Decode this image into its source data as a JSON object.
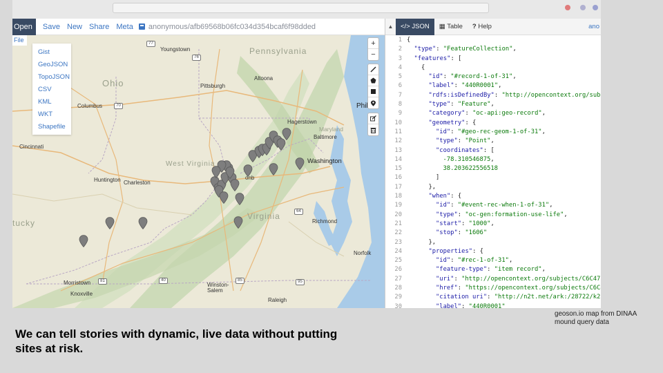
{
  "toolbar": {
    "open_label": "Open",
    "items": [
      "Save",
      "New",
      "Share",
      "Meta"
    ],
    "user_text": "anonymous/afb69568b06fc034d354bcaf6f98dded"
  },
  "file_menu": {
    "label": "File",
    "items": [
      "Gist",
      "GeoJSON",
      "TopoJSON",
      "CSV",
      "KML",
      "WKT",
      "Shapefile"
    ]
  },
  "map": {
    "state_labels": [
      "Pennsylvania",
      "Ohio",
      "West Virginia",
      "Virginia",
      "Maryland",
      "tucky"
    ],
    "places": [
      "Youngstown",
      "Pittsburgh",
      "Altoona",
      "Columbus",
      "Phil",
      "Hagerstown",
      "Baltimore",
      "Cincinnati",
      "Washington",
      "Huntington",
      "Charleston",
      "onb",
      "Richmond",
      "Norfolk",
      "Morristown",
      "Knoxville",
      "Winston-Salem",
      "Raleigh"
    ],
    "routes": [
      "77",
      "76",
      "70",
      "81",
      "40",
      "85",
      "95",
      "64"
    ],
    "controls": [
      "search-icon",
      "zoom-in",
      "zoom-out",
      "draw-line",
      "draw-polygon",
      "draw-rectangle",
      "draw-marker",
      "edit",
      "delete"
    ],
    "zoom_in": "+",
    "zoom_out": "−"
  },
  "panel": {
    "collapse_glyph": "▲",
    "tabs": [
      "JSON",
      "Table",
      "Help"
    ],
    "tab_prefixes": [
      "</>",
      "▦",
      "?"
    ],
    "active_tab": "JSON",
    "user_short": "ano",
    "lines": [
      {
        "n": "1",
        "i": 0,
        "parts": [
          [
            "{",
            "pun"
          ]
        ]
      },
      {
        "n": "2",
        "i": 1,
        "parts": [
          [
            "\"type\"",
            "key"
          ],
          [
            ": ",
            "pun"
          ],
          [
            "\"FeatureCollection\"",
            "str"
          ],
          [
            ",",
            "pun"
          ]
        ]
      },
      {
        "n": "3",
        "i": 1,
        "parts": [
          [
            "\"features\"",
            "key"
          ],
          [
            ": [",
            "pun"
          ]
        ]
      },
      {
        "n": "4",
        "i": 2,
        "parts": [
          [
            "{",
            "pun"
          ]
        ]
      },
      {
        "n": "5",
        "i": 3,
        "parts": [
          [
            "\"id\"",
            "key"
          ],
          [
            ": ",
            "pun"
          ],
          [
            "\"#record-1-of-31\"",
            "str"
          ],
          [
            ",",
            "pun"
          ]
        ]
      },
      {
        "n": "6",
        "i": 3,
        "parts": [
          [
            "\"label\"",
            "key"
          ],
          [
            ": ",
            "pun"
          ],
          [
            "\"440R0001\"",
            "str"
          ],
          [
            ",",
            "pun"
          ]
        ]
      },
      {
        "n": "7",
        "i": 3,
        "parts": [
          [
            "\"rdfs:isDefinedBy\"",
            "key"
          ],
          [
            ": ",
            "pun"
          ],
          [
            "\"http://opencontext.org/subj",
            "str"
          ]
        ]
      },
      {
        "n": "8",
        "i": 3,
        "parts": [
          [
            "\"type\"",
            "key"
          ],
          [
            ": ",
            "pun"
          ],
          [
            "\"Feature\"",
            "str"
          ],
          [
            ",",
            "pun"
          ]
        ]
      },
      {
        "n": "9",
        "i": 3,
        "parts": [
          [
            "\"category\"",
            "key"
          ],
          [
            ": ",
            "pun"
          ],
          [
            "\"oc-api:geo-record\"",
            "str"
          ],
          [
            ",",
            "pun"
          ]
        ]
      },
      {
        "n": "10",
        "i": 3,
        "parts": [
          [
            "\"geometry\"",
            "key"
          ],
          [
            ": {",
            "pun"
          ]
        ]
      },
      {
        "n": "11",
        "i": 4,
        "parts": [
          [
            "\"id\"",
            "key"
          ],
          [
            ": ",
            "pun"
          ],
          [
            "\"#geo-rec-geom-1-of-31\"",
            "str"
          ],
          [
            ",",
            "pun"
          ]
        ]
      },
      {
        "n": "12",
        "i": 4,
        "parts": [
          [
            "\"type\"",
            "key"
          ],
          [
            ": ",
            "pun"
          ],
          [
            "\"Point\"",
            "str"
          ],
          [
            ",",
            "pun"
          ]
        ]
      },
      {
        "n": "13",
        "i": 4,
        "parts": [
          [
            "\"coordinates\"",
            "key"
          ],
          [
            ": [",
            "pun"
          ]
        ]
      },
      {
        "n": "14",
        "i": 5,
        "parts": [
          [
            "-78.310546875",
            "num"
          ],
          [
            ",",
            "pun"
          ]
        ]
      },
      {
        "n": "15",
        "i": 5,
        "parts": [
          [
            "38.203622556518",
            "num"
          ]
        ]
      },
      {
        "n": "16",
        "i": 4,
        "parts": [
          [
            "]",
            "pun"
          ]
        ]
      },
      {
        "n": "17",
        "i": 3,
        "parts": [
          [
            "},",
            "pun"
          ]
        ]
      },
      {
        "n": "18",
        "i": 3,
        "parts": [
          [
            "\"when\"",
            "key"
          ],
          [
            ": {",
            "pun"
          ]
        ]
      },
      {
        "n": "19",
        "i": 4,
        "parts": [
          [
            "\"id\"",
            "key"
          ],
          [
            ": ",
            "pun"
          ],
          [
            "\"#event-rec-when-1-of-31\"",
            "str"
          ],
          [
            ",",
            "pun"
          ]
        ]
      },
      {
        "n": "20",
        "i": 4,
        "parts": [
          [
            "\"type\"",
            "key"
          ],
          [
            ": ",
            "pun"
          ],
          [
            "\"oc-gen:formation-use-life\"",
            "str"
          ],
          [
            ",",
            "pun"
          ]
        ]
      },
      {
        "n": "21",
        "i": 4,
        "parts": [
          [
            "\"start\"",
            "key"
          ],
          [
            ": ",
            "pun"
          ],
          [
            "\"1000\"",
            "str"
          ],
          [
            ",",
            "pun"
          ]
        ]
      },
      {
        "n": "22",
        "i": 4,
        "parts": [
          [
            "\"stop\"",
            "key"
          ],
          [
            ": ",
            "pun"
          ],
          [
            "\"1606\"",
            "str"
          ]
        ]
      },
      {
        "n": "23",
        "i": 3,
        "parts": [
          [
            "},",
            "pun"
          ]
        ]
      },
      {
        "n": "24",
        "i": 3,
        "parts": [
          [
            "\"properties\"",
            "key"
          ],
          [
            ": {",
            "pun"
          ]
        ]
      },
      {
        "n": "25",
        "i": 4,
        "parts": [
          [
            "\"id\"",
            "key"
          ],
          [
            ": ",
            "pun"
          ],
          [
            "\"#rec-1-of-31\"",
            "str"
          ],
          [
            ",",
            "pun"
          ]
        ]
      },
      {
        "n": "26",
        "i": 4,
        "parts": [
          [
            "\"feature-type\"",
            "key"
          ],
          [
            ": ",
            "pun"
          ],
          [
            "\"item record\"",
            "str"
          ],
          [
            ",",
            "pun"
          ]
        ]
      },
      {
        "n": "27",
        "i": 4,
        "parts": [
          [
            "\"uri\"",
            "key"
          ],
          [
            ": ",
            "pun"
          ],
          [
            "\"http://opencontext.org/subjects/C6C47",
            "str"
          ]
        ]
      },
      {
        "n": "28",
        "i": 4,
        "parts": [
          [
            "\"href\"",
            "key"
          ],
          [
            ": ",
            "pun"
          ],
          [
            "\"https://opencontext.org/subjects/C6C4",
            "str"
          ]
        ]
      },
      {
        "n": "29",
        "i": 4,
        "parts": [
          [
            "\"citation uri\"",
            "key"
          ],
          [
            ": ",
            "pun"
          ],
          [
            "\"http://n2t.net/ark:/28722/k2",
            "str"
          ]
        ]
      },
      {
        "n": "30",
        "i": 4,
        "parts": [
          [
            "\"label\"",
            "key"
          ],
          [
            ": ",
            "pun"
          ],
          [
            "\"440R0001\"",
            "str"
          ]
        ]
      }
    ]
  },
  "caption": "geoson.io map from DINAA mound query data",
  "headline": "We can tell stories with dynamic, live data without putting sites at risk."
}
